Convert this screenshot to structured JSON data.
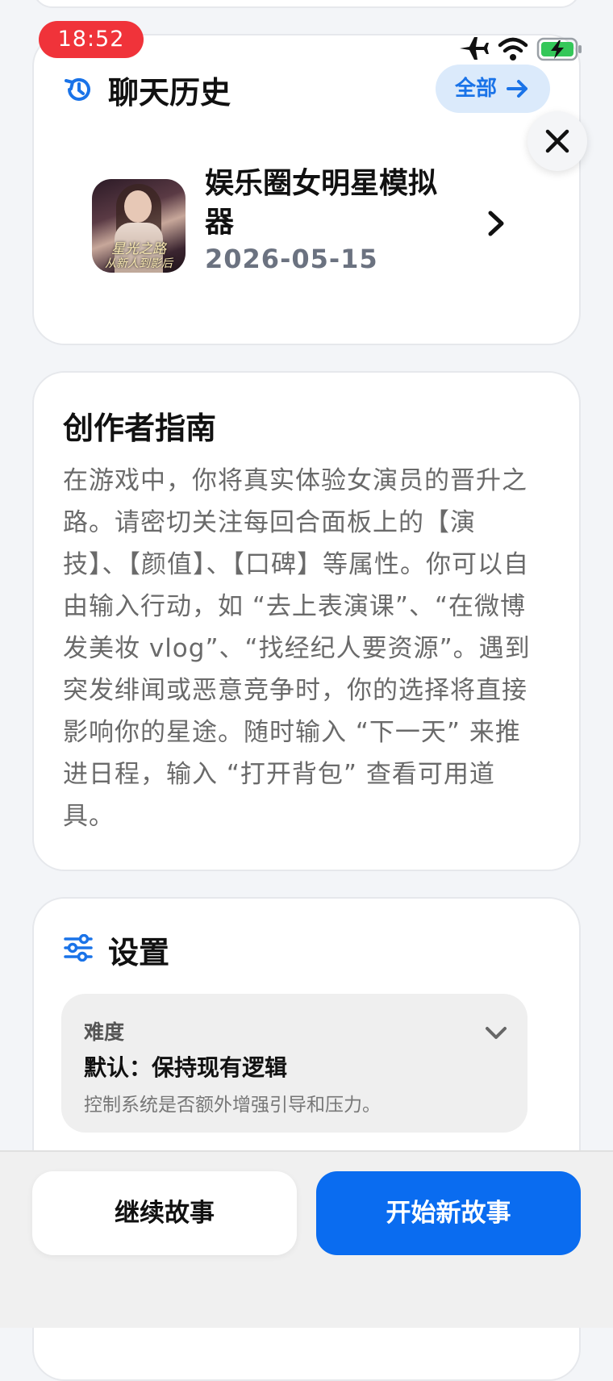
{
  "status_bar": {
    "time": "18:52",
    "icons": [
      "airplane-icon",
      "wifi-icon",
      "battery-charging-icon"
    ]
  },
  "history": {
    "title": "聊天历史",
    "all_button": "全部",
    "item": {
      "thumbnail_caption_1": "星光之路",
      "thumbnail_caption_2": "从新人到影后",
      "name": "娱乐圈女明星模拟器",
      "date": "2026-05-15"
    }
  },
  "guide": {
    "title": "创作者指南",
    "body": "在游戏中，你将真实体验女演员的晋升之路。请密切关注每回合面板上的【演技】、【颜值】、【口碑】等属性。你可以自由输入行动，如 “去上表演课”、“在微博发美妆 vlog”、“找经纪人要资源”。遇到突发绯闻或恶意竞争时，你的选择将直接影响你的星途。随时输入 “下一天” 来推进日程，输入 “打开背包” 查看可用道具。"
  },
  "settings": {
    "title": "设置",
    "difficulty": {
      "label": "难度",
      "value": "默认：保持现有逻辑",
      "help": "控制系统是否额外增强引导和压力。"
    }
  },
  "actions": {
    "continue": "继续故事",
    "new_story": "开始新故事"
  },
  "colors": {
    "accent": "#0a6cf0",
    "status_time_bg": "#f0333a",
    "battery_green": "#34c759"
  }
}
